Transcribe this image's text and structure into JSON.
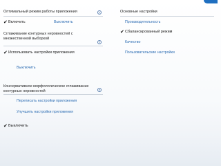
{
  "left": {
    "perf_mode": {
      "title": "Оптимальный режим работы приложения",
      "help": "?",
      "options": [
        {
          "label": "Включить",
          "checked": true
        },
        {
          "label": "Выключить",
          "checked": false
        }
      ]
    },
    "msaa": {
      "title": "Сглаживание контурных неровностей с множественной выборкой",
      "help": "?",
      "options": [
        {
          "label": "Использовать настройки приложения",
          "checked": true
        },
        {
          "label": "Выключить",
          "checked": false
        }
      ]
    },
    "mlaa": {
      "title": "Консервативное морфологическое сглаживание контурных неровностей",
      "help": "?",
      "options": [
        {
          "label": "Переписать настройки приложения",
          "checked": false
        },
        {
          "label": "Улучшить настройки приложения",
          "checked": false
        },
        {
          "label": "Выключить",
          "checked": true
        }
      ]
    }
  },
  "right": {
    "basic": {
      "title": "Основные настройки",
      "options": [
        {
          "label": "Производительность",
          "checked": false
        },
        {
          "label": "Сбалансированный режим",
          "checked": true
        },
        {
          "label": "Качество",
          "checked": false
        },
        {
          "label": "Пользовательские настройки",
          "checked": false
        }
      ]
    }
  },
  "glyphs": {
    "check": "✔"
  },
  "colors": {
    "link": "#2d6db3",
    "accent_tab": "#1f6fc0",
    "rule": "#c9d1da"
  }
}
